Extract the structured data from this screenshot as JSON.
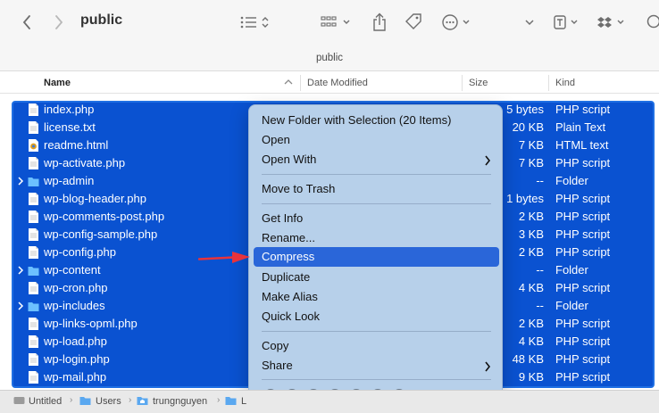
{
  "window": {
    "title": "public",
    "path_title": "public"
  },
  "columns": {
    "name": "Name",
    "date_modified": "Date Modified",
    "size": "Size",
    "kind": "Kind"
  },
  "files": [
    {
      "name": "index.php",
      "size": "5 bytes",
      "kind": "PHP script",
      "icon": "document-icon",
      "folder": false
    },
    {
      "name": "license.txt",
      "size": "20 KB",
      "kind": "Plain Text",
      "icon": "document-icon",
      "folder": false
    },
    {
      "name": "readme.html",
      "size": "7 KB",
      "kind": "HTML text",
      "icon": "chrome-html-icon",
      "folder": false
    },
    {
      "name": "wp-activate.php",
      "size": "7 KB",
      "kind": "PHP script",
      "icon": "document-icon",
      "folder": false
    },
    {
      "name": "wp-admin",
      "size": "--",
      "kind": "Folder",
      "icon": "folder-icon",
      "folder": true
    },
    {
      "name": "wp-blog-header.php",
      "size": "1 bytes",
      "kind": "PHP script",
      "icon": "document-icon",
      "folder": false
    },
    {
      "name": "wp-comments-post.php",
      "size": "2 KB",
      "kind": "PHP script",
      "icon": "document-icon",
      "folder": false
    },
    {
      "name": "wp-config-sample.php",
      "size": "3 KB",
      "kind": "PHP script",
      "icon": "document-icon",
      "folder": false
    },
    {
      "name": "wp-config.php",
      "size": "2 KB",
      "kind": "PHP script",
      "icon": "document-icon",
      "folder": false
    },
    {
      "name": "wp-content",
      "size": "--",
      "kind": "Folder",
      "icon": "folder-icon",
      "folder": true
    },
    {
      "name": "wp-cron.php",
      "size": "4 KB",
      "kind": "PHP script",
      "icon": "document-icon",
      "folder": false
    },
    {
      "name": "wp-includes",
      "size": "--",
      "kind": "Folder",
      "icon": "folder-icon",
      "folder": true
    },
    {
      "name": "wp-links-opml.php",
      "size": "2 KB",
      "kind": "PHP script",
      "icon": "document-icon",
      "folder": false
    },
    {
      "name": "wp-load.php",
      "size": "4 KB",
      "kind": "PHP script",
      "icon": "document-icon",
      "folder": false
    },
    {
      "name": "wp-login.php",
      "size": "48 KB",
      "kind": "PHP script",
      "icon": "document-icon",
      "folder": false
    },
    {
      "name": "wp-mail.php",
      "size": "9 KB",
      "kind": "PHP script",
      "icon": "document-icon",
      "folder": false
    }
  ],
  "context_menu": {
    "new_folder": "New Folder with Selection (20 Items)",
    "open": "Open",
    "open_with": "Open With",
    "move_to_trash": "Move to Trash",
    "get_info": "Get Info",
    "rename": "Rename...",
    "compress": "Compress",
    "duplicate": "Duplicate",
    "make_alias": "Make Alias",
    "quick_look": "Quick Look",
    "copy": "Copy",
    "share": "Share"
  },
  "breadcrumbs": [
    "Untitled",
    "Users",
    "trungnguyen",
    "L"
  ],
  "colors": {
    "selection": "#0a52d1",
    "menu_bg": "#b7d0ea",
    "highlight": "#2a66d9",
    "arrow": "#e8333b"
  }
}
